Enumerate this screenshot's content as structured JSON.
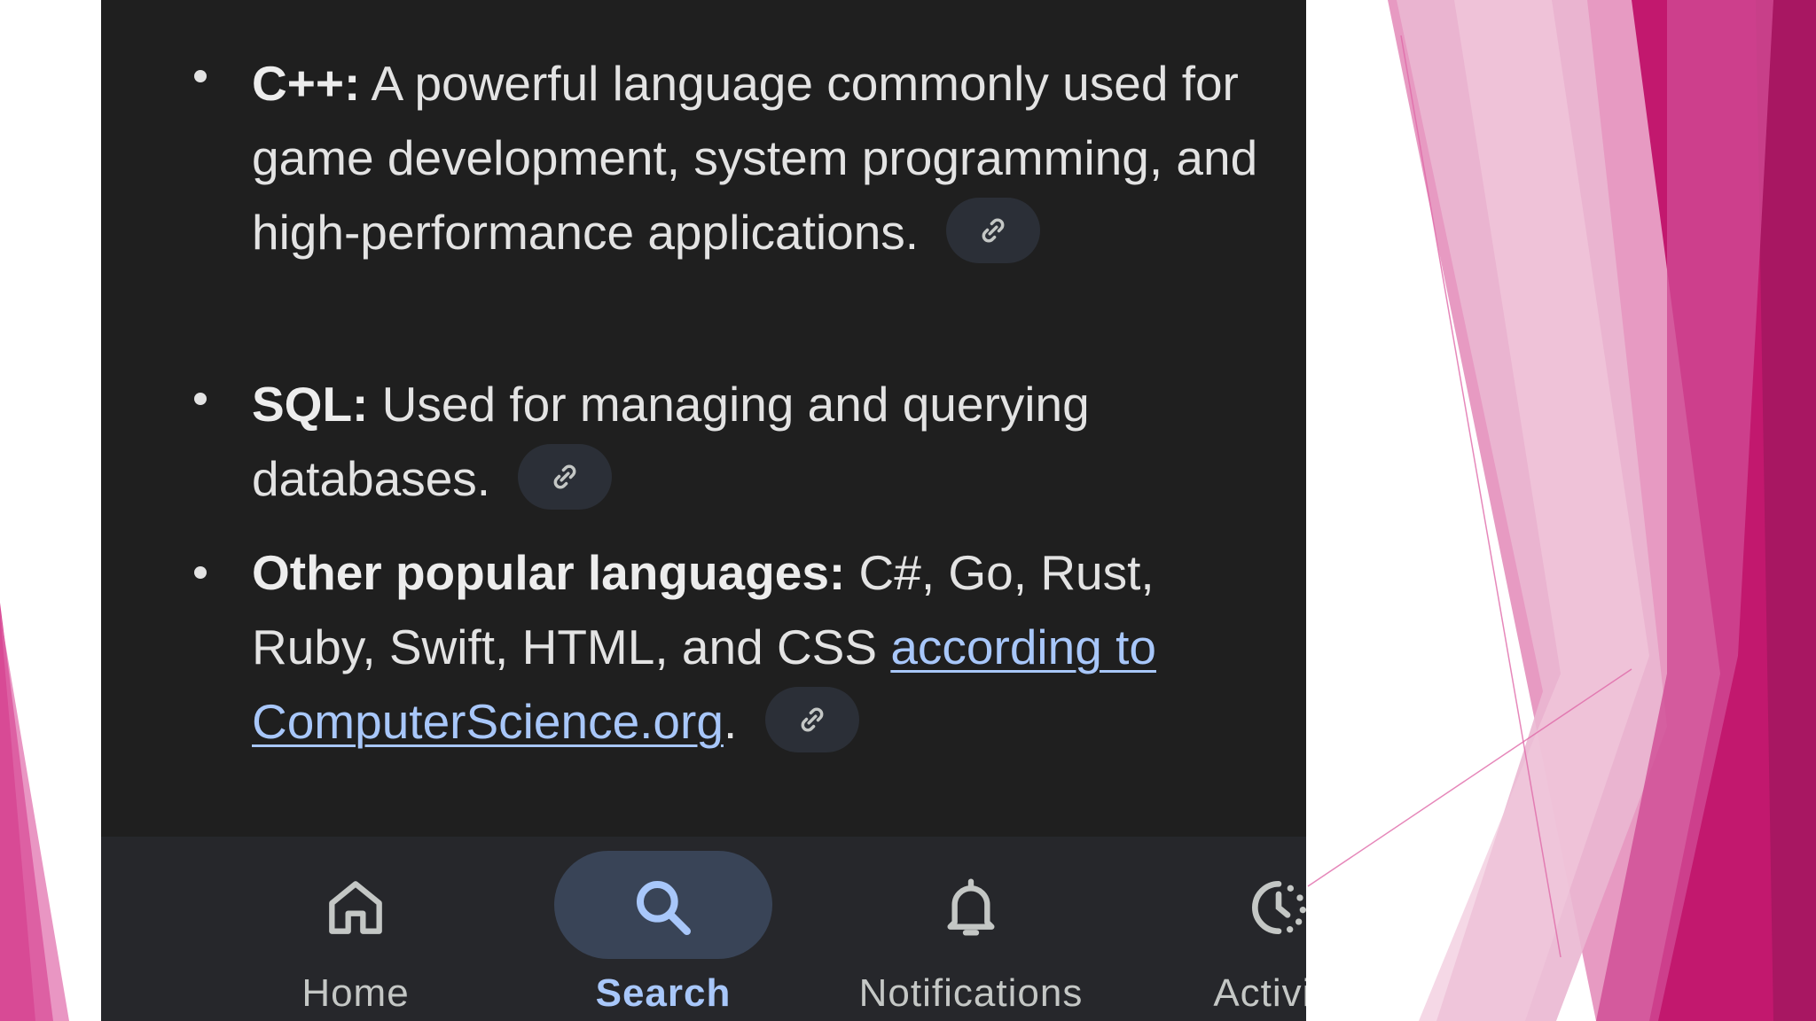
{
  "content": {
    "items": [
      {
        "term": "C++:",
        "description": "A powerful language commonly used for game development, system programming, and high-performance applications."
      },
      {
        "term": "SQL:",
        "description": "Used for managing and querying databases."
      },
      {
        "term": "Other popular languages:",
        "description": "C#, Go, Rust, Ruby, Swift, HTML, and CSS",
        "link_text": "according to ComputerScience.org",
        "trailing": "."
      }
    ]
  },
  "bottom_nav": {
    "items": [
      {
        "label": "Home",
        "icon": "home-icon",
        "active": false
      },
      {
        "label": "Search",
        "icon": "search-icon",
        "active": true
      },
      {
        "label": "Notifications",
        "icon": "bell-icon",
        "active": false
      },
      {
        "label": "Activity",
        "icon": "activity-icon",
        "active": false
      }
    ]
  },
  "colors": {
    "panel_background": "#1f1f1f",
    "nav_background": "#26272b",
    "active_pill": "#394457",
    "link": "#a8c7fa",
    "text": "#e3e3e3",
    "slide_accent": "#c2186e"
  }
}
